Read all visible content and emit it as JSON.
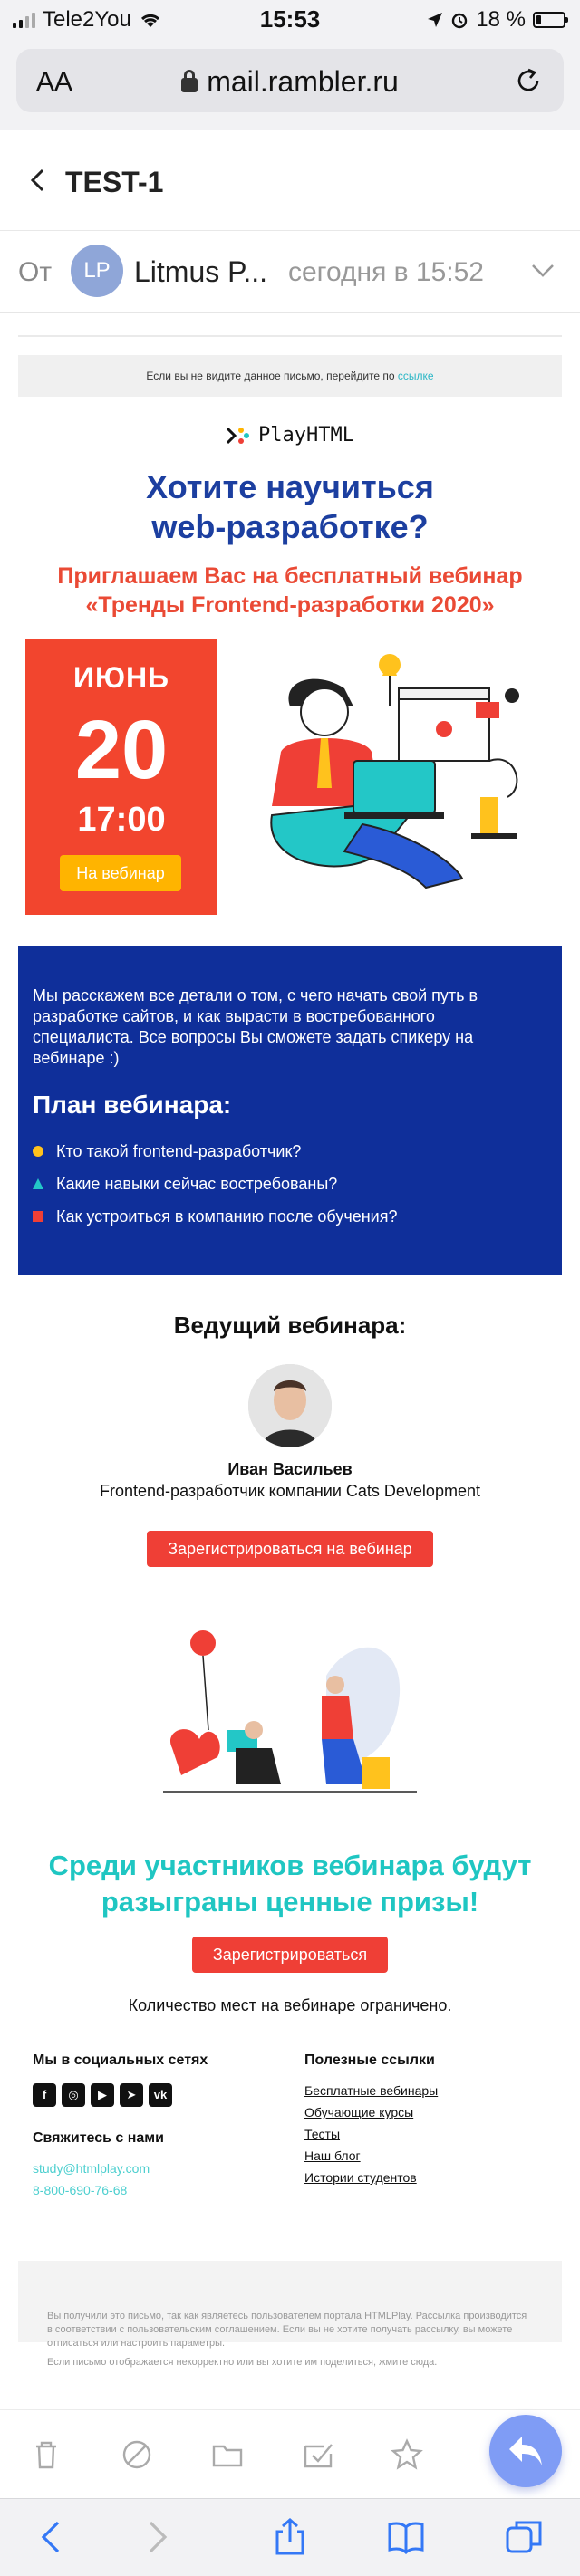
{
  "status_bar": {
    "carrier": "Tele2You",
    "time": "15:53",
    "battery": "18 %"
  },
  "browser": {
    "text_size": "AA",
    "url": "mail.rambler.ru"
  },
  "mail": {
    "subject": "TEST-1",
    "from_label": "От",
    "sender_initials": "LP",
    "sender_name": "Litmus P...",
    "date": "сегодня в 15:52"
  },
  "email": {
    "preheader_text": "Если вы не видите данное письмо, перейдите по",
    "preheader_link": "ссылке",
    "logo_text": "PlayHTML",
    "headline_1": "Хотите научиться",
    "headline_2": "web-разработке?",
    "subhead_1": "Приглашаем Вас на бесплатный вебинар",
    "subhead_2": "«Тренды Frontend-разработки 2020»",
    "date_card": {
      "month": "ИЮНЬ",
      "day": "20",
      "time": "17:00",
      "button": "На вебинар"
    },
    "intro": "Мы расскажем все детали о том, с чего начать свой путь в разработке сайтов, и как вырасти в востребованного специалиста. Все вопросы Вы сможете задать спикеру на вебинаре :)",
    "plan_title": "План вебинара:",
    "plan_items": [
      "Кто такой frontend-разработчик?",
      "Какие навыки сейчас востребованы?",
      "Как устроиться в компанию после обучения?"
    ],
    "host_title": "Ведущий вебинара:",
    "host_name": "Иван Васильев",
    "host_role": "Frontend-разработчик компании Cats Development",
    "register_button": "Зарегистрироваться на вебинар",
    "prizes_1": "Среди участников вебинара будут",
    "prizes_2": "разыграны ценные призы!",
    "register_button_2": "Зарегистрироваться",
    "limited": "Количество мест на вебинаре ограничено.",
    "footer": {
      "social_title": "Мы в социальных сетях",
      "contact_title": "Свяжитесь с нами",
      "email": "study@htmlplay.com",
      "phone": "8-800-690-76-68",
      "links_title": "Полезные ссылки",
      "links": [
        "Бесплатные вебинары",
        "Обучающие курсы",
        "Тесты",
        "Наш блог",
        "Истории студентов"
      ]
    },
    "legal_1": "Вы получили это письмо, так как являетесь пользователем портала HTMLPlay. Рассылка производится в соответствии с пользовательским соглашением. Если вы не хотите получать рассылку, вы можете отписаться или настроить параметры.",
    "legal_2": "Если письмо отображается некорректно или вы хотите им поделиться, жмите сюда."
  },
  "colors": {
    "brand_blue": "#1c3fa0",
    "accent_red": "#ef3f36",
    "accent_teal": "#1fc6c2",
    "accent_yellow": "#ffb400",
    "box_blue": "#0f2f9a"
  },
  "icons": {
    "mail_toolbar": [
      "trash-icon",
      "spam-icon",
      "folder-icon",
      "mark-read-icon",
      "star-icon",
      "reply-icon"
    ],
    "safari_toolbar": [
      "back-icon",
      "forward-icon",
      "share-icon",
      "bookmarks-icon",
      "tabs-icon"
    ]
  }
}
